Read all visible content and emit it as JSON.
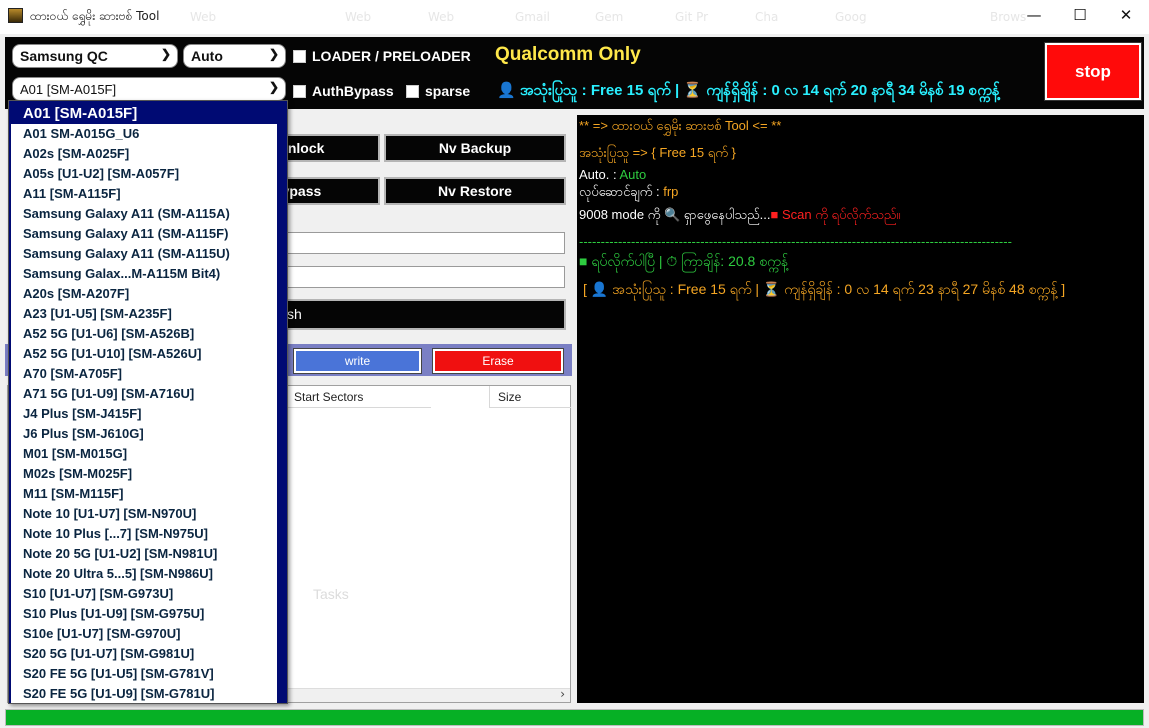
{
  "window": {
    "title": "ထားဝယ် ရွှေမိုး ဆားဗစ်  Tool",
    "ghost_tabs": [
      "Web",
      "Web",
      "Web",
      "Gmail",
      "Gem",
      "Git Pr",
      "Cha",
      "Goog",
      "Brows"
    ],
    "minimize": "—",
    "maximize": "☐",
    "close": "✕"
  },
  "toolbar": {
    "brand_select": "Samsung QC",
    "mode_select": "Auto",
    "loader_label": "LOADER / PRELOADER",
    "qualcomm_label": "Qualcomm Only",
    "model_select": "A01 [SM-A015F]",
    "authbypass_label": "AuthBypass",
    "sparse_label": "sparse",
    "status_line": "👤 အသုံးပြုသူ : Free 15 ရက် | ⏳ ကျန်ရှိချိန် : 0 လ 14 ရက် 20 နာရီ 34 မိနစ် 19 စက္ကန့်",
    "stop_label": "stop"
  },
  "left": {
    "buttons": {
      "unlock": "er Unlock",
      "nv_backup": "Nv Backup",
      "bypass": "l Bypass",
      "nv_restore": "Nv Restore",
      "flash": "sh",
      "write": "write",
      "erase": "Erase"
    },
    "grid_columns": [
      "Start Sectors",
      "Size"
    ],
    "ghost_text": "Tasks"
  },
  "console": {
    "lines": [
      {
        "text": "** => ထားဝယ် ရွှေမိုး ဆားဗစ် Tool <= **",
        "color": "#f5a623"
      },
      {
        "text": "အသုံးပြုသူ => { Free 15 ရက် }",
        "color": "#f5a623"
      },
      {
        "prefix": "Auto. : ",
        "value": "Auto",
        "prefix_color": "#ffffff",
        "value_color": "#2ecc40"
      },
      {
        "prefix": "လုပ်ဆောင်ချက် : ",
        "value": "frp",
        "prefix_color": "#ffffff",
        "value_color": "#f5a623"
      },
      {
        "prefix": "9008 mode ကို 🔍 ရှာဖွေနေပါသည်...",
        "value": "■ Scan ကို ရပ်လိုက်သည်။",
        "prefix_color": "#ffffff",
        "value_color": "#ff2020"
      },
      {
        "text": "----------------------------------------------------------------------------------------------------",
        "color": "#2ecc40"
      },
      {
        "text": "■ ရပ်လိုက်ပါပြီ | ⏱ ကြာချိန်: 20.8 စက္ကန့်",
        "color": "#2ecc40"
      },
      {
        "text": "[ 👤 အသုံးပြုသူ : Free 15 ရက် | ⏳ ကျန်ရှိချိန် : 0 လ 14 ရက် 23 နာရီ 27 မိနစ် 48 စက္ကန့် ]",
        "color": "#f5a623"
      }
    ]
  },
  "dropdown": {
    "items": [
      "A01 [SM-A015F]",
      "A01 SM-A015G_U6",
      "A02s [SM-A025F]",
      "A05s [U1-U2] [SM-A057F]",
      "A11 [SM-A115F]",
      "Samsung Galaxy A11 (SM-A115A)",
      "Samsung Galaxy A11 (SM-A115F)",
      "Samsung Galaxy A11 (SM-A115U)",
      "Samsung  Galax...M-A115M Bit4)",
      "A20s [SM-A207F]",
      "A23 [U1-U5] [SM-A235F]",
      "A52 5G [U1-U6] [SM-A526B]",
      "A52 5G [U1-U10] [SM-A526U]",
      "A70 [SM-A705F]",
      "A71 5G [U1-U9] [SM-A716U]",
      "J4 Plus [SM-J415F]",
      "J6 Plus [SM-J610G]",
      "M01 [SM-M015G]",
      "M02s [SM-M025F]",
      "M11 [SM-M115F]",
      "Note 10 [U1-U7] [SM-N970U]",
      "Note 10 Plus [...7] [SM-N975U]",
      "Note 20 5G [U1-U2] [SM-N981U]",
      "Note 20 Ultra 5...5] [SM-N986U]",
      "S10 [U1-U7] [SM-G973U]",
      "S10 Plus [U1-U9] [SM-G975U]",
      "S10e [U1-U7] [SM-G970U]",
      "S20 5G [U1-U7] [SM-G981U]",
      "S20 FE 5G [U1-U5] [SM-G781V]",
      "S20 FE 5G [U1-U9] [SM-G781U]"
    ],
    "selected_index": 0
  },
  "progress": {
    "value": 1.0,
    "color": "#06b025"
  },
  "icons": [
    "app-icon",
    "chevron-down-icon",
    "checkbox-icon",
    "user-icon",
    "hourglass-icon",
    "search-icon",
    "timer-icon",
    "scroll-right-icon"
  ]
}
